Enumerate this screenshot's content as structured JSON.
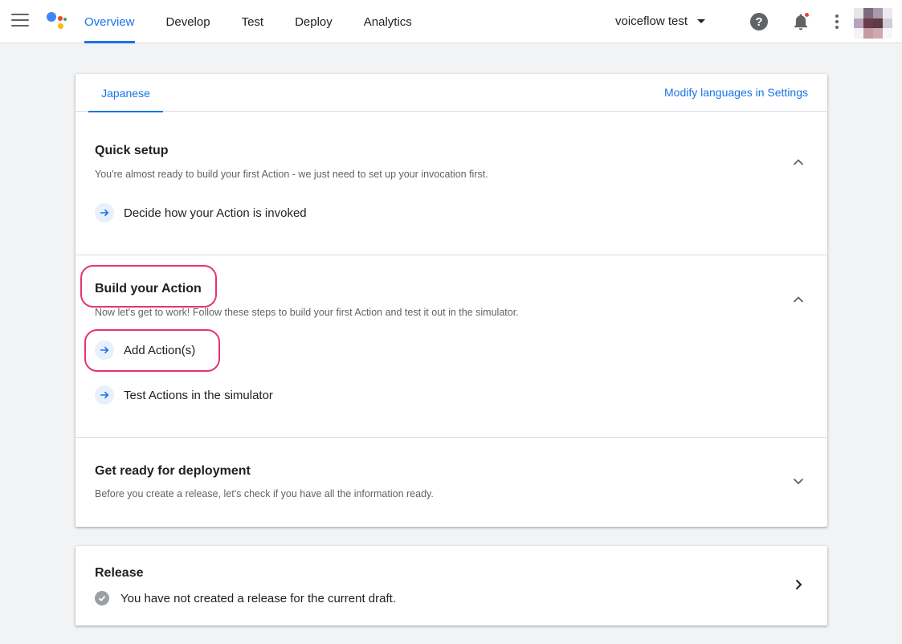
{
  "topbar": {
    "nav": [
      "Overview",
      "Develop",
      "Test",
      "Deploy",
      "Analytics"
    ],
    "active_tab": "Overview",
    "project_name": "voiceflow test",
    "help_glyph": "?",
    "icons": [
      "menu-icon",
      "assistant-logo-icon",
      "help-icon",
      "bell-icon",
      "more-vert-icon",
      "avatar"
    ]
  },
  "language": {
    "tab": "Japanese",
    "modify_link": "Modify languages in Settings"
  },
  "sections": {
    "quick_setup": {
      "title": "Quick setup",
      "description": "You're almost ready to build your first Action - we just need to set up your invocation first.",
      "steps": [
        "Decide how your Action is invoked"
      ],
      "state": "expanded"
    },
    "build": {
      "title": "Build your Action",
      "description": "Now let's get to work! Follow these steps to build your first Action and test it out in the simulator.",
      "steps": [
        "Add Action(s)",
        "Test Actions in the simulator"
      ],
      "state": "expanded"
    },
    "deploy": {
      "title": "Get ready for deployment",
      "description": "Before you create a release, let's check if you have all the information ready.",
      "state": "collapsed"
    }
  },
  "release": {
    "title": "Release",
    "status": "You have not created a release for the current draft."
  },
  "colors": {
    "accent": "#1a73e8",
    "highlight": "#e8336e",
    "background": "#f1f3f4"
  }
}
